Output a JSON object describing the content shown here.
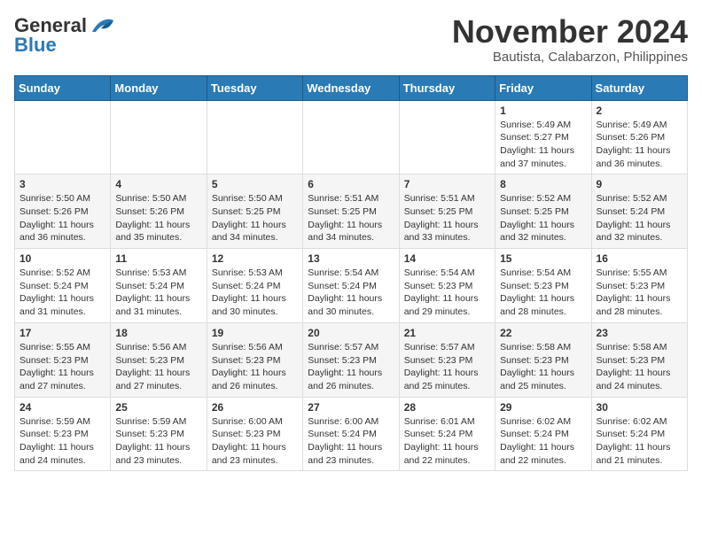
{
  "header": {
    "logo_general": "General",
    "logo_blue": "Blue",
    "month": "November 2024",
    "location": "Bautista, Calabarzon, Philippines"
  },
  "weekdays": [
    "Sunday",
    "Monday",
    "Tuesday",
    "Wednesday",
    "Thursday",
    "Friday",
    "Saturday"
  ],
  "weeks": [
    [
      {
        "day": "",
        "info": ""
      },
      {
        "day": "",
        "info": ""
      },
      {
        "day": "",
        "info": ""
      },
      {
        "day": "",
        "info": ""
      },
      {
        "day": "",
        "info": ""
      },
      {
        "day": "1",
        "info": "Sunrise: 5:49 AM\nSunset: 5:27 PM\nDaylight: 11 hours and 37 minutes."
      },
      {
        "day": "2",
        "info": "Sunrise: 5:49 AM\nSunset: 5:26 PM\nDaylight: 11 hours and 36 minutes."
      }
    ],
    [
      {
        "day": "3",
        "info": "Sunrise: 5:50 AM\nSunset: 5:26 PM\nDaylight: 11 hours and 36 minutes."
      },
      {
        "day": "4",
        "info": "Sunrise: 5:50 AM\nSunset: 5:26 PM\nDaylight: 11 hours and 35 minutes."
      },
      {
        "day": "5",
        "info": "Sunrise: 5:50 AM\nSunset: 5:25 PM\nDaylight: 11 hours and 34 minutes."
      },
      {
        "day": "6",
        "info": "Sunrise: 5:51 AM\nSunset: 5:25 PM\nDaylight: 11 hours and 34 minutes."
      },
      {
        "day": "7",
        "info": "Sunrise: 5:51 AM\nSunset: 5:25 PM\nDaylight: 11 hours and 33 minutes."
      },
      {
        "day": "8",
        "info": "Sunrise: 5:52 AM\nSunset: 5:25 PM\nDaylight: 11 hours and 32 minutes."
      },
      {
        "day": "9",
        "info": "Sunrise: 5:52 AM\nSunset: 5:24 PM\nDaylight: 11 hours and 32 minutes."
      }
    ],
    [
      {
        "day": "10",
        "info": "Sunrise: 5:52 AM\nSunset: 5:24 PM\nDaylight: 11 hours and 31 minutes."
      },
      {
        "day": "11",
        "info": "Sunrise: 5:53 AM\nSunset: 5:24 PM\nDaylight: 11 hours and 31 minutes."
      },
      {
        "day": "12",
        "info": "Sunrise: 5:53 AM\nSunset: 5:24 PM\nDaylight: 11 hours and 30 minutes."
      },
      {
        "day": "13",
        "info": "Sunrise: 5:54 AM\nSunset: 5:24 PM\nDaylight: 11 hours and 30 minutes."
      },
      {
        "day": "14",
        "info": "Sunrise: 5:54 AM\nSunset: 5:23 PM\nDaylight: 11 hours and 29 minutes."
      },
      {
        "day": "15",
        "info": "Sunrise: 5:54 AM\nSunset: 5:23 PM\nDaylight: 11 hours and 28 minutes."
      },
      {
        "day": "16",
        "info": "Sunrise: 5:55 AM\nSunset: 5:23 PM\nDaylight: 11 hours and 28 minutes."
      }
    ],
    [
      {
        "day": "17",
        "info": "Sunrise: 5:55 AM\nSunset: 5:23 PM\nDaylight: 11 hours and 27 minutes."
      },
      {
        "day": "18",
        "info": "Sunrise: 5:56 AM\nSunset: 5:23 PM\nDaylight: 11 hours and 27 minutes."
      },
      {
        "day": "19",
        "info": "Sunrise: 5:56 AM\nSunset: 5:23 PM\nDaylight: 11 hours and 26 minutes."
      },
      {
        "day": "20",
        "info": "Sunrise: 5:57 AM\nSunset: 5:23 PM\nDaylight: 11 hours and 26 minutes."
      },
      {
        "day": "21",
        "info": "Sunrise: 5:57 AM\nSunset: 5:23 PM\nDaylight: 11 hours and 25 minutes."
      },
      {
        "day": "22",
        "info": "Sunrise: 5:58 AM\nSunset: 5:23 PM\nDaylight: 11 hours and 25 minutes."
      },
      {
        "day": "23",
        "info": "Sunrise: 5:58 AM\nSunset: 5:23 PM\nDaylight: 11 hours and 24 minutes."
      }
    ],
    [
      {
        "day": "24",
        "info": "Sunrise: 5:59 AM\nSunset: 5:23 PM\nDaylight: 11 hours and 24 minutes."
      },
      {
        "day": "25",
        "info": "Sunrise: 5:59 AM\nSunset: 5:23 PM\nDaylight: 11 hours and 23 minutes."
      },
      {
        "day": "26",
        "info": "Sunrise: 6:00 AM\nSunset: 5:23 PM\nDaylight: 11 hours and 23 minutes."
      },
      {
        "day": "27",
        "info": "Sunrise: 6:00 AM\nSunset: 5:24 PM\nDaylight: 11 hours and 23 minutes."
      },
      {
        "day": "28",
        "info": "Sunrise: 6:01 AM\nSunset: 5:24 PM\nDaylight: 11 hours and 22 minutes."
      },
      {
        "day": "29",
        "info": "Sunrise: 6:02 AM\nSunset: 5:24 PM\nDaylight: 11 hours and 22 minutes."
      },
      {
        "day": "30",
        "info": "Sunrise: 6:02 AM\nSunset: 5:24 PM\nDaylight: 11 hours and 21 minutes."
      }
    ]
  ]
}
